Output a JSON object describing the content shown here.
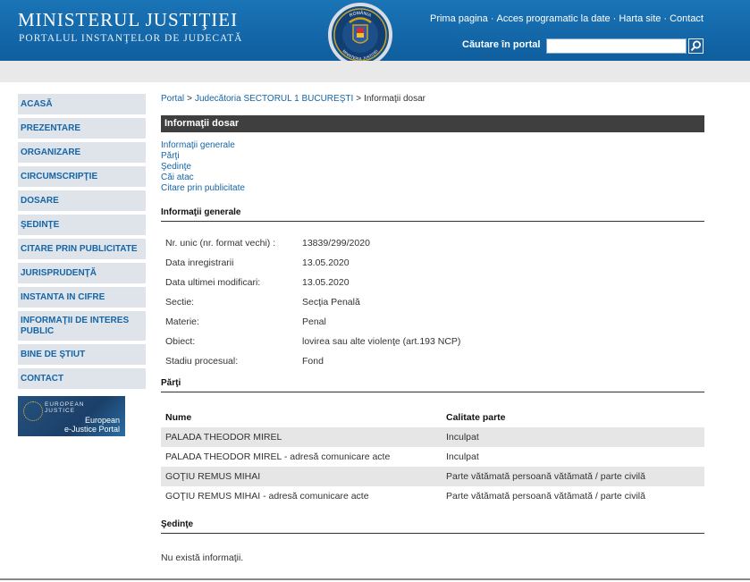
{
  "header": {
    "title": "MINISTERUL JUSTIŢIEI",
    "subtitle": "PORTALUL INSTANŢELOR DE JUDECATĂ",
    "nav": [
      "Prima pagina",
      "Acces programatic la date",
      "Harta site",
      "Contact"
    ],
    "search_label": "Căutare în portal",
    "search_value": "",
    "emblem_text_top": "ROMÂNIA",
    "emblem_text_bottom": "MINISTERUL JUSTIŢIEI"
  },
  "sidebar": {
    "items": [
      "ACASĂ",
      "PREZENTARE",
      "ORGANIZARE",
      "CIRCUMSCRIPŢIE",
      "DOSARE",
      "ŞEDINŢE",
      "CITARE PRIN PUBLICITATE",
      "JURISPRUDENŢĂ",
      "INSTANTA IN CIFRE",
      "INFORMAŢII DE INTERES PUBLIC",
      "BINE DE ŞTIUT",
      "CONTACT"
    ],
    "ejustice": {
      "logo_line1": "EUROPEAN",
      "logo_line2": "JUSTICE",
      "portal_line1": "European",
      "portal_line2": "e-Justice Portal"
    }
  },
  "breadcrumb": {
    "items": [
      "Portal",
      "Judecătoria SECTORUL 1 BUCUREŞTI",
      "Informaţii dosar"
    ]
  },
  "main": {
    "title": "Informaţii dosar",
    "anchors": [
      "Informaţii generale",
      "Părţi",
      "Şedinţe",
      "Căi atac",
      "Citare prin publicitate"
    ],
    "general": {
      "heading": "Informaţii generale",
      "rows": [
        {
          "label": "Nr. unic (nr. format vechi) :",
          "value": "13839/299/2020"
        },
        {
          "label": "Data inregistrarii",
          "value": "13.05.2020"
        },
        {
          "label": "Data ultimei modificari:",
          "value": "13.05.2020"
        },
        {
          "label": "Sectie:",
          "value": "Secţia Penală"
        },
        {
          "label": "Materie:",
          "value": "Penal"
        },
        {
          "label": "Obiect:",
          "value": "lovirea sau alte violenţe (art.193 NCP)"
        },
        {
          "label": "Stadiu procesual:",
          "value": "Fond"
        }
      ]
    },
    "parties": {
      "heading": "Părţi",
      "columns": [
        "Nume",
        "Calitate parte"
      ],
      "rows": [
        [
          "PALADA THEODOR MIREL",
          "Inculpat"
        ],
        [
          "PALADA THEODOR MIREL - adresă comunicare acte",
          "Inculpat"
        ],
        [
          "GOŢIU REMUS MIHAI",
          "Parte vătămată persoană vătămată / parte civilă"
        ],
        [
          "GOŢIU REMUS MIHAI - adresă comunicare acte",
          "Parte vătămată persoană vătămată / parte civilă"
        ]
      ]
    },
    "hearings": {
      "heading": "Şedinţe",
      "empty_text": "Nu există informaţii."
    }
  },
  "colors": {
    "header_blue": "#1a74b6",
    "link_blue": "#1565a7",
    "sidebar_bg": "#dfe4ea",
    "title_bar": "#3f3f3f",
    "row_shade": "#e6e6e6"
  },
  "icons": [
    "search-icon",
    "emblem-icon",
    "ejustice-logo-icon"
  ]
}
